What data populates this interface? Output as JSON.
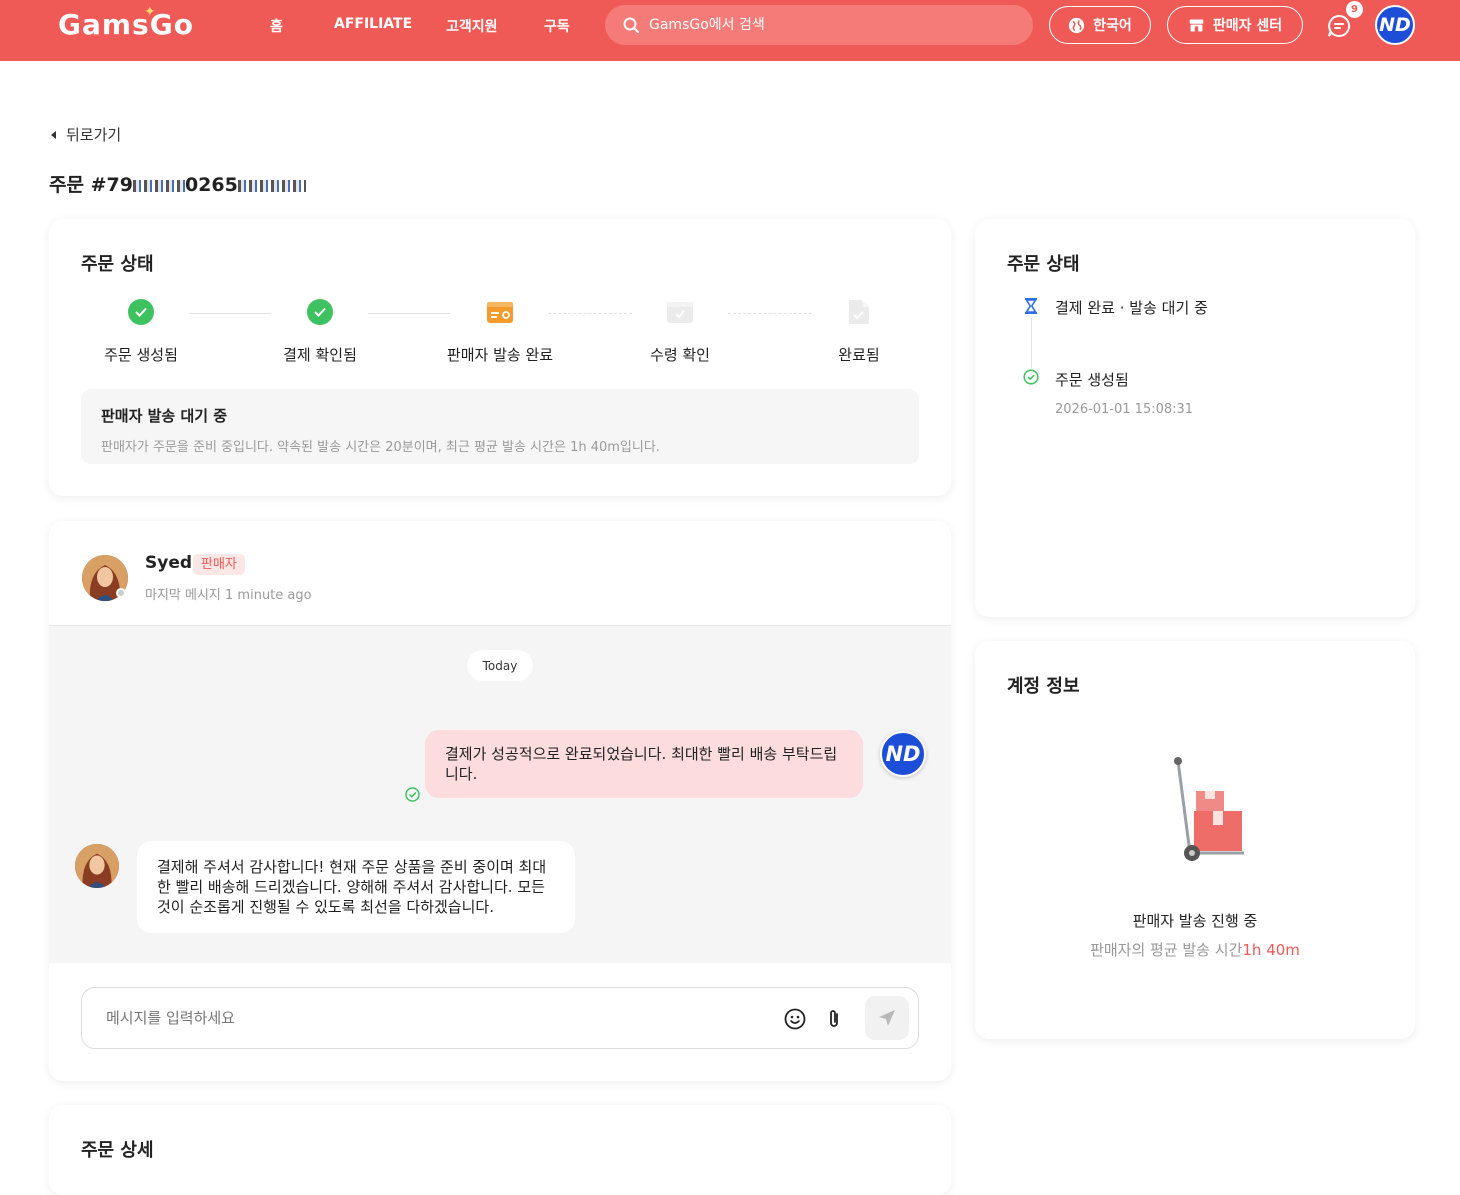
{
  "header": {
    "logo": "GamsGo",
    "nav": [
      "홈",
      "AFFILIATE",
      "고객지원",
      "구독"
    ],
    "search_placeholder": "GamsGo에서 검색",
    "language": "한국어",
    "seller_center": "판매자 센터",
    "message_badge": "9",
    "user_initials": "ND"
  },
  "page": {
    "back": "뒤로가기",
    "order_label": "주문 #79",
    "order_mid": "0265"
  },
  "status_card": {
    "title": "주문 상태",
    "steps": [
      "주문 생성됨",
      "결제 확인됨",
      "판매자 발송 완료",
      "수령 확인",
      "완료됨"
    ],
    "notice_title": "판매자 발송 대기 중",
    "notice_desc": "판매자가 주문을 준비 중입니다. 약속된 발송 시간은 20분이며, 최근 평균 발송 시간은 1h 40m입니다."
  },
  "chat": {
    "seller_name": "Syed",
    "seller_tag": "판매자",
    "last_message": "마지막 메시지 1 minute ago",
    "date_divider": "Today",
    "my_message": "결제가 성공적으로 완료되었습니다. 최대한 빨리 배송 부탁드립니다.",
    "seller_message": "결제해 주셔서 감사합니다! 현재 주문 상품을 준비 중이며 최대한 빨리 배송해 드리겠습니다. 양해해 주셔서 감사합니다. 모든 것이 순조롭게 진행될 수 있도록 최선을 다하겠습니다.",
    "input_placeholder": "메시지를 입력하세요"
  },
  "order_detail": {
    "title": "주문 상세"
  },
  "side_status": {
    "title": "주문 상태",
    "items": [
      {
        "text": "결제 완료 · 발송 대기 중",
        "time": ""
      },
      {
        "text": "주문 생성됨",
        "time": "2026-01-01 15:08:31"
      }
    ]
  },
  "account": {
    "title": "계정 정보",
    "status": "판매자 발송 진행 중",
    "avg_label": "판매자의 평균 발송 시간",
    "avg_value": "1h 40m"
  },
  "colors": {
    "brand": "#ef5a57",
    "success": "#3ec25f",
    "warning": "#f39c2b"
  }
}
